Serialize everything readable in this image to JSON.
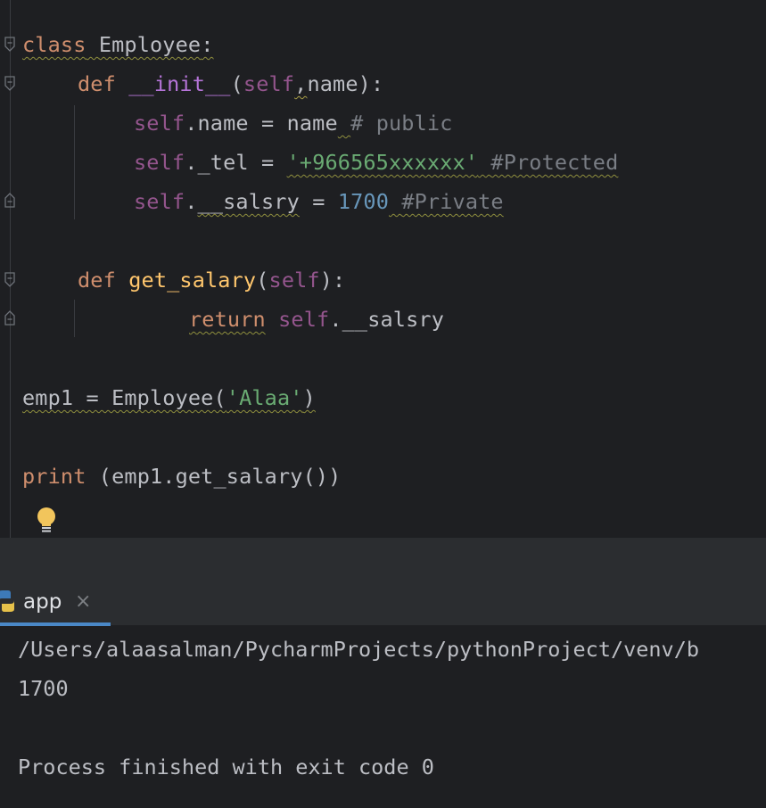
{
  "editor": {
    "lines": [
      {
        "parts": [
          "class",
          " ",
          "Employee",
          ":"
        ]
      },
      {
        "parts": [
          "def",
          " ",
          "__init__",
          "(",
          "self",
          ",",
          "name",
          "):"
        ]
      },
      {
        "parts": [
          "self",
          ".name = name",
          " ",
          "# public"
        ]
      },
      {
        "parts": [
          "self",
          "._tel = ",
          "'+966565xxxxxx'",
          " ",
          "#Protected"
        ]
      },
      {
        "parts": [
          "self",
          ".",
          "__salsry",
          " = ",
          "1700",
          " ",
          "#Private"
        ]
      },
      {
        "parts": []
      },
      {
        "parts": [
          "def",
          " ",
          "get_salary",
          "(",
          "self",
          "):"
        ]
      },
      {
        "parts": [
          "return",
          " ",
          "self",
          ".__salsry"
        ]
      },
      {
        "parts": []
      },
      {
        "parts": [
          "emp1 = Employee(",
          "'Alaa'",
          ")"
        ]
      },
      {
        "parts": []
      },
      {
        "parts": [
          "print",
          " (emp1.get_salary())"
        ]
      }
    ]
  },
  "run_panel": {
    "tab_label": "app",
    "close_symbol": "×",
    "icon": "python-icon"
  },
  "console": {
    "lines": [
      "/Users/alaasalman/PycharmProjects/pythonProject/venv/b",
      "1700",
      "",
      "Process finished with exit code 0"
    ]
  },
  "icons": {
    "bulb": "lightbulb-icon",
    "fold": "fold-marker-icon"
  },
  "colors": {
    "keyword": "#cf8e6d",
    "self": "#94558d",
    "string": "#6aab73",
    "number": "#6897bb",
    "function_def": "#ffc66d",
    "comment": "#7a7e85",
    "accent": "#4a88c7"
  }
}
